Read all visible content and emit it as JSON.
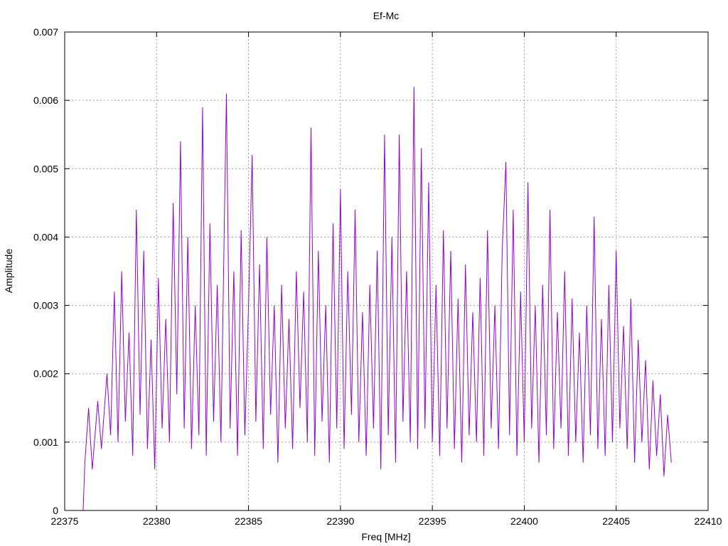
{
  "chart_data": {
    "type": "line",
    "title": "Ef-Mc",
    "xlabel": "Freq [MHz]",
    "ylabel": "Amplitude",
    "xlim": [
      22375,
      22410
    ],
    "ylim": [
      0,
      0.007
    ],
    "x_ticks": [
      22375,
      22380,
      22385,
      22390,
      22395,
      22400,
      22405,
      22410
    ],
    "x_tick_labels": [
      "22375",
      "22380",
      "22385",
      "22390",
      "22395",
      "22400",
      "22405",
      "22410"
    ],
    "y_ticks": [
      0,
      0.001,
      0.002,
      0.003,
      0.004,
      0.005,
      0.006,
      0.007
    ],
    "y_tick_labels": [
      "0",
      "0.001",
      "0.002",
      "0.003",
      "0.004",
      "0.005",
      "0.006",
      "0.007"
    ],
    "grid": true,
    "legend": "none",
    "series": [
      {
        "color": "#9400d3",
        "x": [
          22376.0,
          22376.1,
          22376.3,
          22376.5,
          22376.8,
          22377.0,
          22377.3,
          22377.5,
          22377.7,
          22377.9,
          22378.1,
          22378.3,
          22378.5,
          22378.7,
          22378.9,
          22379.1,
          22379.3,
          22379.5,
          22379.7,
          22379.9,
          22380.1,
          22380.3,
          22380.5,
          22380.7,
          22380.9,
          22381.1,
          22381.3,
          22381.5,
          22381.7,
          22381.9,
          22382.1,
          22382.3,
          22382.5,
          22382.7,
          22382.9,
          22383.1,
          22383.3,
          22383.5,
          22383.7,
          22383.8,
          22384.0,
          22384.2,
          22384.4,
          22384.6,
          22384.8,
          22385.0,
          22385.2,
          22385.4,
          22385.6,
          22385.8,
          22386.0,
          22386.2,
          22386.4,
          22386.6,
          22386.8,
          22387.0,
          22387.2,
          22387.4,
          22387.6,
          22387.8,
          22388.0,
          22388.2,
          22388.4,
          22388.6,
          22388.8,
          22389.0,
          22389.2,
          22389.4,
          22389.6,
          22389.8,
          22390.0,
          22390.2,
          22390.4,
          22390.6,
          22390.8,
          22391.0,
          22391.2,
          22391.4,
          22391.6,
          22391.8,
          22392.0,
          22392.2,
          22392.4,
          22392.6,
          22392.8,
          22393.0,
          22393.2,
          22393.4,
          22393.6,
          22393.8,
          22394.0,
          22394.2,
          22394.4,
          22394.6,
          22394.8,
          22395.0,
          22395.2,
          22395.4,
          22395.6,
          22395.8,
          22396.0,
          22396.2,
          22396.4,
          22396.6,
          22396.8,
          22397.0,
          22397.2,
          22397.4,
          22397.6,
          22397.8,
          22398.0,
          22398.2,
          22398.4,
          22398.6,
          22398.8,
          22399.0,
          22399.2,
          22399.4,
          22399.6,
          22399.8,
          22400.0,
          22400.2,
          22400.4,
          22400.6,
          22400.8,
          22401.0,
          22401.2,
          22401.4,
          22401.6,
          22401.8,
          22402.0,
          22402.2,
          22402.4,
          22402.6,
          22402.8,
          22403.0,
          22403.2,
          22403.4,
          22403.6,
          22403.8,
          22404.0,
          22404.2,
          22404.4,
          22404.6,
          22404.8,
          22405.0,
          22405.2,
          22405.4,
          22405.6,
          22405.8,
          22406.0,
          22406.2,
          22406.4,
          22406.6,
          22406.8,
          22407.0,
          22407.2,
          22407.4,
          22407.6,
          22407.8,
          22408.0
        ],
        "y": [
          0.0,
          0.0007,
          0.0015,
          0.0006,
          0.0016,
          0.0009,
          0.002,
          0.0011,
          0.0032,
          0.001,
          0.0035,
          0.0013,
          0.0026,
          0.0008,
          0.0044,
          0.0014,
          0.0038,
          0.0009,
          0.0025,
          0.0006,
          0.0034,
          0.0012,
          0.0028,
          0.001,
          0.0045,
          0.0017,
          0.0054,
          0.0012,
          0.004,
          0.0009,
          0.003,
          0.0011,
          0.0059,
          0.0008,
          0.0042,
          0.0013,
          0.0033,
          0.001,
          0.0045,
          0.0061,
          0.0012,
          0.0035,
          0.0008,
          0.0041,
          0.0011,
          0.003,
          0.0052,
          0.0013,
          0.0036,
          0.0009,
          0.004,
          0.0014,
          0.003,
          0.0007,
          0.0033,
          0.0012,
          0.0028,
          0.0009,
          0.0035,
          0.0015,
          0.0032,
          0.001,
          0.0056,
          0.0008,
          0.0038,
          0.0013,
          0.003,
          0.0007,
          0.0042,
          0.0012,
          0.0047,
          0.0009,
          0.0035,
          0.0014,
          0.0044,
          0.001,
          0.0029,
          0.0008,
          0.0033,
          0.0012,
          0.0038,
          0.0006,
          0.0055,
          0.0011,
          0.004,
          0.0007,
          0.0055,
          0.0013,
          0.0035,
          0.001,
          0.0062,
          0.0009,
          0.0053,
          0.0012,
          0.0048,
          0.001,
          0.0033,
          0.0008,
          0.0041,
          0.0012,
          0.0038,
          0.0009,
          0.0031,
          0.0007,
          0.0036,
          0.0011,
          0.0029,
          0.001,
          0.0034,
          0.0008,
          0.0041,
          0.0012,
          0.003,
          0.0009,
          0.0038,
          0.0051,
          0.0011,
          0.0044,
          0.0008,
          0.0032,
          0.001,
          0.0048,
          0.0012,
          0.003,
          0.0007,
          0.0033,
          0.0011,
          0.0044,
          0.0009,
          0.0029,
          0.0012,
          0.0035,
          0.0008,
          0.0031,
          0.001,
          0.0026,
          0.0007,
          0.003,
          0.0011,
          0.0043,
          0.0009,
          0.0028,
          0.0008,
          0.0033,
          0.001,
          0.0038,
          0.0012,
          0.0027,
          0.0009,
          0.0031,
          0.0007,
          0.0025,
          0.001,
          0.0022,
          0.0006,
          0.0019,
          0.0008,
          0.0017,
          0.0005,
          0.0014,
          0.0007
        ]
      }
    ]
  }
}
